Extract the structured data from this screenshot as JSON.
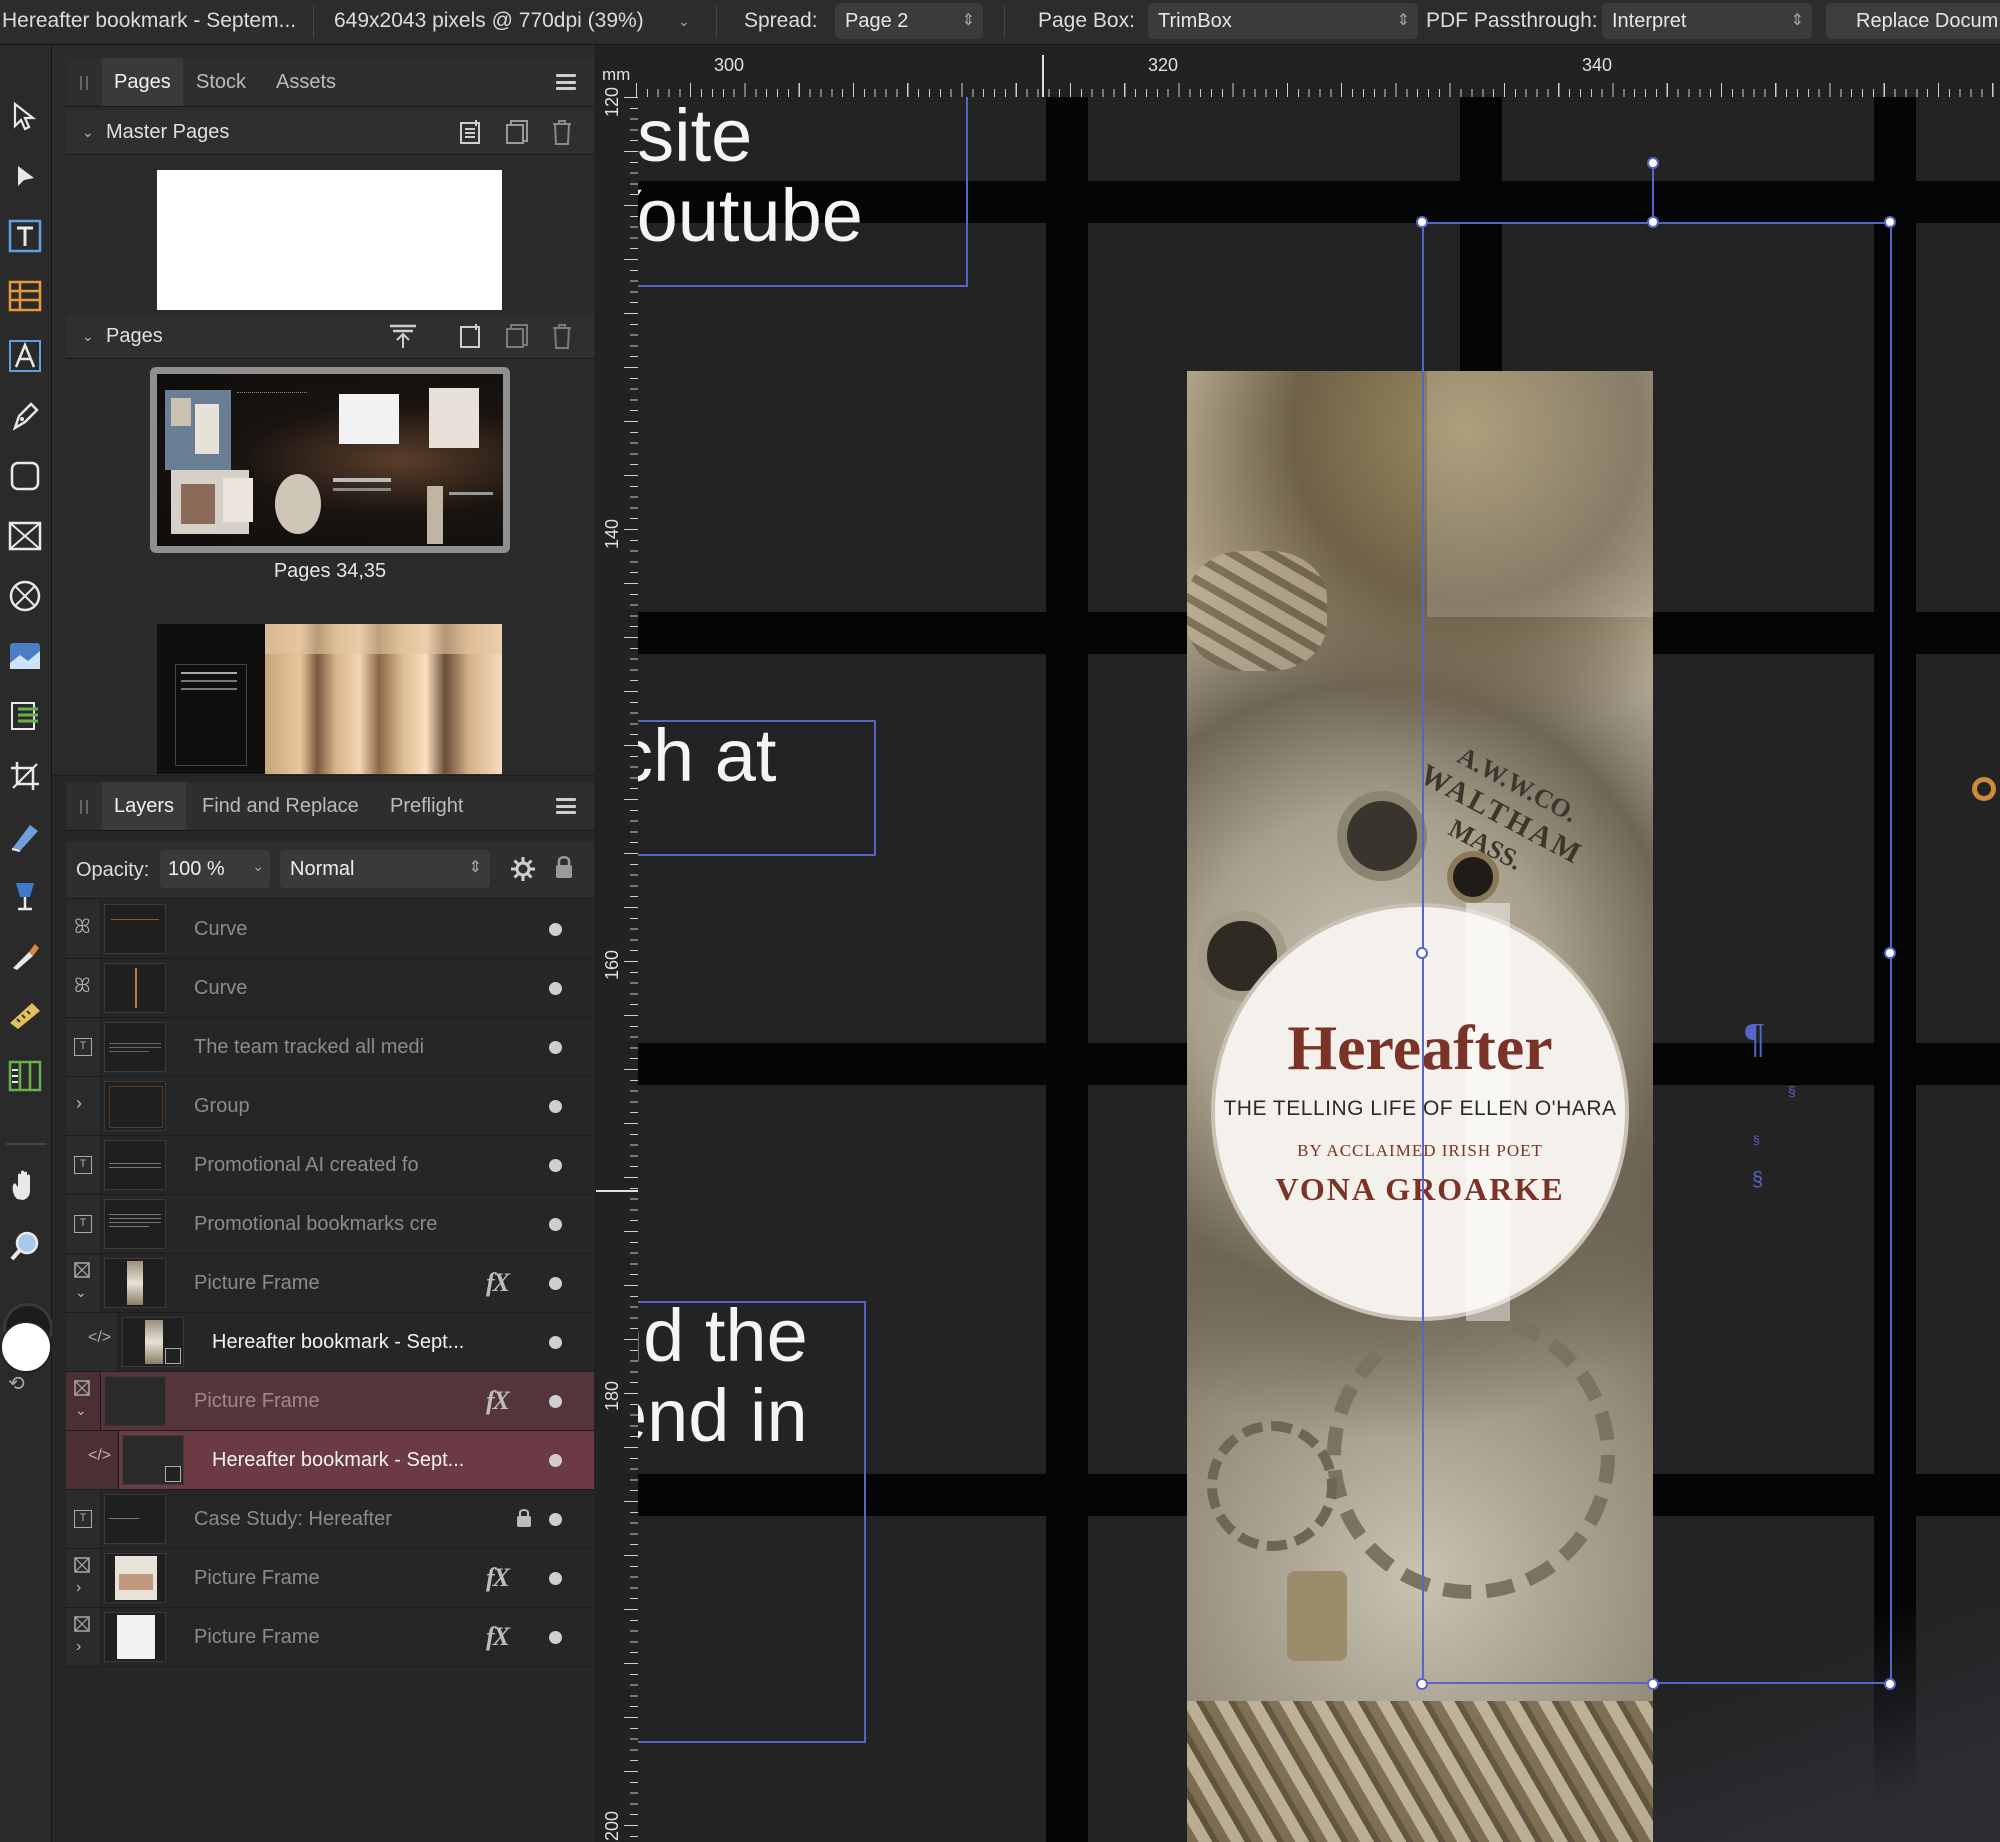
{
  "context_bar": {
    "doc_title": "Hereafter bookmark - Septem...",
    "image_info": "649x2043 pixels @ 770dpi (39%)",
    "spread_label": "Spread:",
    "spread_value": "Page 2",
    "pagebox_label": "Page Box:",
    "pagebox_value": "TrimBox",
    "passthrough_label": "PDF Passthrough:",
    "passthrough_value": "Interpret",
    "replace_button": "Replace Docum"
  },
  "pages_panel": {
    "tabs": [
      "Pages",
      "Stock",
      "Assets"
    ],
    "active_tab": "Pages",
    "master_pages_title": "Master Pages",
    "pages_title": "Pages",
    "page_items": [
      {
        "label": "Pages 34,35"
      },
      {
        "label": ""
      }
    ]
  },
  "layers_panel": {
    "tabs": [
      "Layers",
      "Find and Replace",
      "Preflight"
    ],
    "active_tab": "Layers",
    "opacity_label": "Opacity:",
    "opacity_value": "100 %",
    "blend_mode": "Normal",
    "layers": [
      {
        "name": "Curve",
        "kind": "curve",
        "fx": false,
        "locked": false
      },
      {
        "name": "Curve",
        "kind": "curve",
        "fx": false,
        "locked": false
      },
      {
        "name": "The team tracked all medi",
        "kind": "text",
        "fx": false,
        "locked": false
      },
      {
        "name": "Group",
        "kind": "group",
        "fx": false,
        "locked": false
      },
      {
        "name": "Promotional AI created fo",
        "kind": "text",
        "fx": false,
        "locked": false
      },
      {
        "name": "Promotional bookmarks cre",
        "kind": "text",
        "fx": false,
        "locked": false
      },
      {
        "name": "Picture Frame",
        "kind": "frame",
        "fx": true,
        "locked": false
      },
      {
        "name": "Hereafter bookmark - Sept...",
        "kind": "embedded",
        "fx": false,
        "locked": false
      },
      {
        "name": "Picture Frame",
        "kind": "frame",
        "fx": true,
        "locked": false
      },
      {
        "name": "Hereafter bookmark - Sept...",
        "kind": "embedded",
        "fx": false,
        "locked": false
      },
      {
        "name": "Case Study: Hereafter",
        "kind": "text",
        "fx": false,
        "locked": true
      },
      {
        "name": "Picture Frame",
        "kind": "frame",
        "fx": true,
        "locked": false
      },
      {
        "name": "Picture Frame",
        "kind": "frame",
        "fx": true,
        "locked": false
      }
    ]
  },
  "ruler": {
    "unit": "mm",
    "h_ticks": [
      "300",
      "320",
      "340"
    ],
    "v_ticks": [
      "120",
      "140",
      "160",
      "180",
      "200"
    ]
  },
  "canvas": {
    "text_fragments": [
      "bsite",
      "Youtube",
      "ch at",
      "nd the",
      "end in"
    ],
    "bookmark": {
      "title": "Hereafter",
      "subtitle": "THE TELLING LIFE OF ELLEN O'HARA",
      "byline": "BY ACCLAIMED IRISH POET",
      "author": "VONA GROARKE",
      "watch_engraving": [
        "A.W.W.CO.",
        "WALTHAM",
        "MASS."
      ]
    }
  },
  "colors": {
    "accent_selection": "#6b3a44",
    "guide_blue": "#5865c7",
    "title_brown": "#7a3326"
  }
}
